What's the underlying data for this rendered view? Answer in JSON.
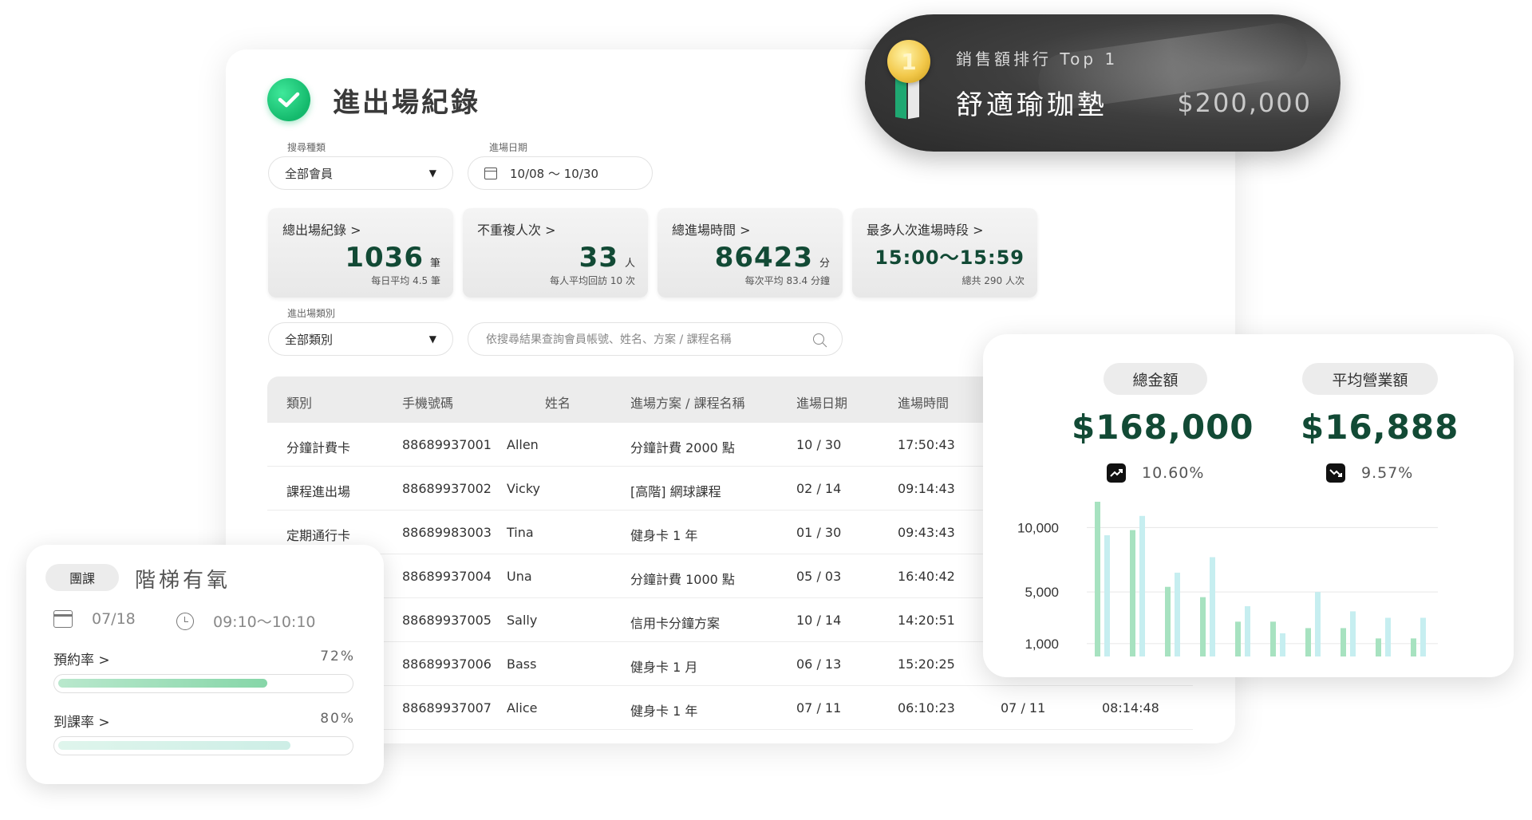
{
  "main": {
    "title": "進出場紀錄",
    "filter1": {
      "label": "搜尋種類",
      "value": "全部會員"
    },
    "filter2": {
      "label": "進場日期",
      "value": "10/08 ～ 10/30"
    },
    "filter3": {
      "label": "進出場類別",
      "value": "全部類別"
    },
    "search_placeholder": "依搜尋結果查詢會員帳號、姓名、方案 / 課程名稱",
    "stats": [
      {
        "label": "總出場紀錄 >",
        "value": "1036",
        "unit": "筆",
        "sub": "每日平均 4.5 筆"
      },
      {
        "label": "不重複人次 >",
        "value": "33",
        "unit": "人",
        "sub": "每人平均回訪 10 次"
      },
      {
        "label": "總進場時間 >",
        "value": "86423",
        "unit": "分",
        "sub": "每次平均 83.4 分鐘"
      },
      {
        "label": "最多人次進場時段 >",
        "value": "15:00～15:59",
        "unit": "",
        "sub": "總共 290 人次"
      }
    ],
    "table": {
      "headers": [
        "類別",
        "手機號碼",
        "姓名",
        "進場方案 / 課程名稱",
        "進場日期",
        "進場時間"
      ],
      "rows": [
        [
          "分鐘計費卡",
          "88689937001",
          "Allen",
          "分鐘計費 2000 點",
          "10 / 30",
          "17:50:43",
          "",
          ""
        ],
        [
          "課程進出場",
          "88689937002",
          "Vicky",
          "[高階] 網球課程",
          "02 / 14",
          "09:14:43",
          "",
          ""
        ],
        [
          "定期通行卡",
          "88689983003",
          "Tina",
          "健身卡 1 年",
          "01 / 30",
          "09:43:43",
          "",
          ""
        ],
        [
          "",
          "88689937004",
          "Una",
          "分鐘計費 1000 點",
          "05 / 03",
          "16:40:42",
          "",
          ""
        ],
        [
          "",
          "88689937005",
          "Sally",
          "信用卡分鐘方案",
          "10 / 14",
          "14:20:51",
          "",
          ""
        ],
        [
          "",
          "88689937006",
          "Bass",
          "健身卡 1 月",
          "06 / 13",
          "15:20:25",
          "",
          ""
        ],
        [
          "",
          "88689937007",
          "Alice",
          "健身卡 1 年",
          "07 / 11",
          "06:10:23",
          "07 / 11",
          "08:14:48"
        ]
      ]
    }
  },
  "banner": {
    "medal_rank": "1",
    "subtitle": "銷售額排行 Top 1",
    "product": "舒適瑜珈墊",
    "amount": "$200,000"
  },
  "class_card": {
    "type": "團課",
    "name": "階梯有氧",
    "date": "07/18",
    "time": "09:10～10:10",
    "booking_label": "預約率 >",
    "booking_value": "72%",
    "booking_fraction": 0.72,
    "attendance_label": "到課率 >",
    "attendance_value": "80%",
    "attendance_fraction": 0.8
  },
  "revenue": {
    "total_label": "總金額",
    "total_value": "$168,000",
    "total_change": "10.60%",
    "avg_label": "平均營業額",
    "avg_value": "$16,888",
    "avg_change": "9.57%",
    "colors": {
      "dark_green": "#124a35",
      "bar_green": "#a7e2c0",
      "bar_cyan": "#c6eef0"
    }
  },
  "chart_data": {
    "type": "bar",
    "categories": [
      "1",
      "2",
      "3",
      "4",
      "5",
      "6",
      "7",
      "8",
      "9",
      "10"
    ],
    "yticks": [
      "10,000",
      "5,000",
      "1,000"
    ],
    "ylim": [
      0,
      12000
    ],
    "series": [
      {
        "values": [
          12000,
          9800,
          5400,
          4600,
          2700,
          2700,
          2200,
          2200,
          1400,
          1400
        ]
      },
      {
        "values": [
          9400,
          10900,
          6500,
          7700,
          3900,
          1800,
          5000,
          3500,
          3000,
          3000
        ]
      }
    ]
  }
}
